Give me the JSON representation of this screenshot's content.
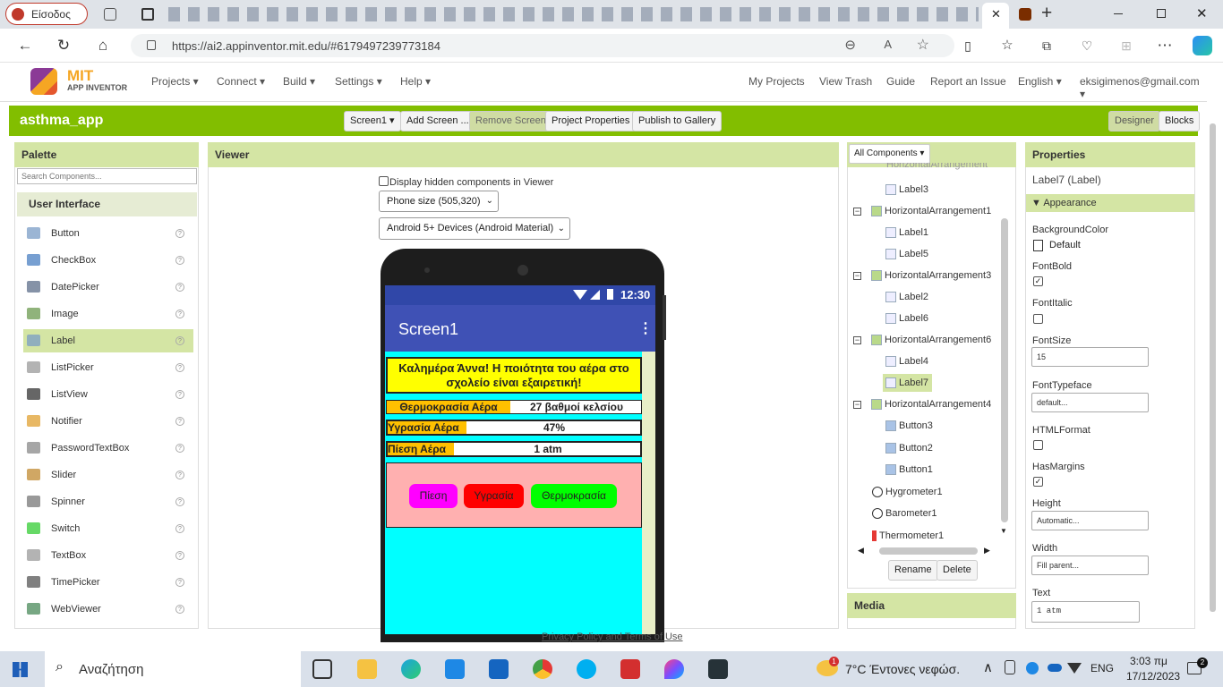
{
  "browser": {
    "tab_label": "Είσοδος",
    "url": "https://ai2.appinventor.mit.edu/#6179497239773184",
    "close_tab_glyph": "✕",
    "new_tab_glyph": "+"
  },
  "header": {
    "logo_top": "MIT",
    "logo_bottom": "APP INVENTOR",
    "menus": [
      "Projects ▾",
      "Connect ▾",
      "Build ▾",
      "Settings ▾",
      "Help ▾"
    ],
    "right_links": [
      "My Projects",
      "View Trash",
      "Guide",
      "Report an Issue",
      "English ▾",
      "eksigimenos@gmail.com ▾"
    ]
  },
  "toolbar": {
    "project_name": "asthma_app",
    "screen_select": "Screen1 ▾",
    "add_screen": "Add Screen ...",
    "remove_screen": "Remove Screen",
    "project_properties": "Project Properties",
    "publish": "Publish to Gallery",
    "designer": "Designer",
    "blocks": "Blocks"
  },
  "palette": {
    "title": "Palette",
    "search_placeholder": "Search Components...",
    "category": "User Interface",
    "items": [
      "Button",
      "CheckBox",
      "DatePicker",
      "Image",
      "Label",
      "ListPicker",
      "ListView",
      "Notifier",
      "PasswordTextBox",
      "Slider",
      "Spinner",
      "Switch",
      "TextBox",
      "TimePicker",
      "WebViewer"
    ],
    "selected": "Label",
    "help_glyph": "?"
  },
  "viewer": {
    "title": "Viewer",
    "hidden_checkbox_label": "Display hidden components in Viewer",
    "size_select": "Phone size (505,320)",
    "theme_select": "Android 5+ Devices (Android Material)",
    "status_time": "12:30",
    "screen_title": "Screen1",
    "greeting": "Καλημέρα Άννα! Η ποιότητα του αέρα στο σχολείο είναι εξαιρετική!",
    "rows": [
      {
        "label": "Θερμοκρασία Αέρα",
        "value": "27 βαθμοί κελσίου"
      },
      {
        "label": "Υγρασία Αέρα",
        "value": "47%"
      },
      {
        "label": "Πίεση Αέρα",
        "value": "1 atm"
      }
    ],
    "buttons": [
      "Πίεση",
      "Υγρασία",
      "Θερμοκρασία"
    ],
    "colors": {
      "magenta": "#ff00ff",
      "red": "#ff0000",
      "green": "#00ff00",
      "yellow": "#ffff00",
      "orange": "#ffc000",
      "pink": "#ffb0b0",
      "cyan": "#00ffff"
    }
  },
  "components": {
    "filter": "All Components ▾",
    "truncated_top": "HorizontalArrangement",
    "tree": [
      {
        "name": "Label3",
        "level": 2
      },
      {
        "name": "HorizontalArrangement1",
        "level": 1
      },
      {
        "name": "Label1",
        "level": 2
      },
      {
        "name": "Label5",
        "level": 2
      },
      {
        "name": "HorizontalArrangement3",
        "level": 1
      },
      {
        "name": "Label2",
        "level": 2
      },
      {
        "name": "Label6",
        "level": 2
      },
      {
        "name": "HorizontalArrangement6",
        "level": 1
      },
      {
        "name": "Label4",
        "level": 2
      },
      {
        "name": "Label7",
        "level": 2
      },
      {
        "name": "HorizontalArrangement4",
        "level": 1
      },
      {
        "name": "Button3",
        "level": 2
      },
      {
        "name": "Button2",
        "level": 2
      },
      {
        "name": "Button1",
        "level": 2
      },
      {
        "name": "Hygrometer1",
        "level": 1
      },
      {
        "name": "Barometer1",
        "level": 1
      },
      {
        "name": "Thermometer1",
        "level": 1
      }
    ],
    "rename": "Rename",
    "delete": "Delete",
    "media": "Media"
  },
  "properties": {
    "title": "Properties",
    "component": "Label7 (Label)",
    "section": "Appearance",
    "bg_color_label": "BackgroundColor",
    "bg_color_value": "Default",
    "fontbold": "FontBold",
    "fontitalic": "FontItalic",
    "fontsize": "FontSize",
    "fontsize_value": "15",
    "fonttypeface": "FontTypeface",
    "fonttypeface_value": "default...",
    "htmlformat": "HTMLFormat",
    "hasmargins": "HasMargins",
    "height": "Height",
    "height_value": "Automatic...",
    "width": "Width",
    "width_value": "Fill parent...",
    "text": "Text",
    "text_value": "1 atm"
  },
  "footer": {
    "privacy": "Privacy Policy and Terms of Use"
  },
  "taskbar": {
    "search": "Αναζήτηση",
    "weather": "7°C  Έντονες νεφώσ.",
    "weather_badge": "1",
    "lang": "ENG",
    "time": "3:03 πμ",
    "date": "17/12/2023",
    "notif_count": "2"
  }
}
